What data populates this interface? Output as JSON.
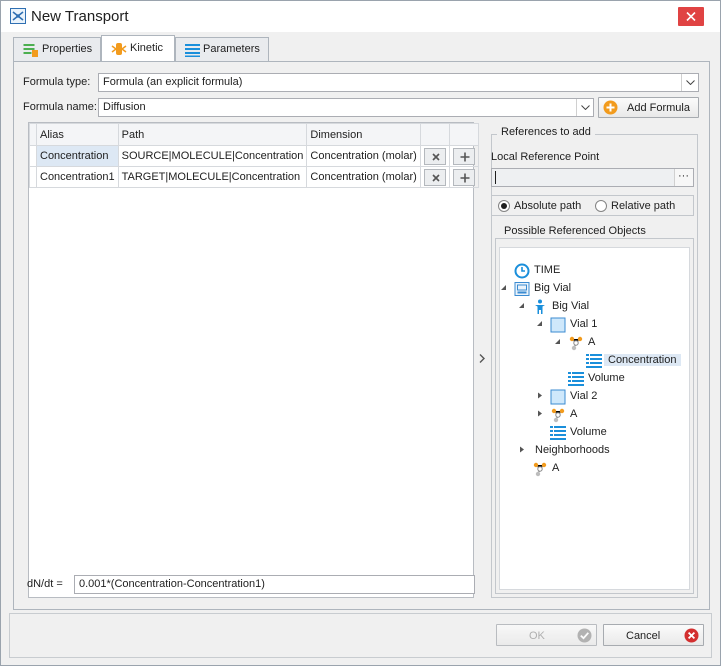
{
  "window": {
    "title": "New Transport"
  },
  "tabs": [
    {
      "label": "Properties",
      "active": false
    },
    {
      "label": "Kinetic",
      "active": true
    },
    {
      "label": "Parameters",
      "active": false
    }
  ],
  "form": {
    "formula_type_label": "Formula type:",
    "formula_type_value": "Formula (an explicit formula)",
    "formula_name_label": "Formula name:",
    "formula_name_value": "Diffusion",
    "add_formula_label": "Add Formula"
  },
  "grid": {
    "headers": [
      "Alias",
      "Path",
      "Dimension"
    ],
    "rows": [
      {
        "alias": "Concentration",
        "path": "SOURCE|MOLECULE|Concentration",
        "dimension": "Concentration (molar)"
      },
      {
        "alias": "Concentration1",
        "path": "TARGET|MOLECULE|Concentration",
        "dimension": "Concentration (molar)"
      }
    ]
  },
  "formula": {
    "label": "dN/dt =",
    "expression": "0.001*(Concentration-Concentration1)"
  },
  "references": {
    "title": "References to add",
    "local_ref_label": "Local Reference Point",
    "local_ref_value": "",
    "browse_label": "···",
    "absolute_label": "Absolute path",
    "relative_label": "Relative path",
    "selected_mode": "absolute",
    "tree_title": "Possible Referenced Objects",
    "tree": [
      {
        "label": "TIME",
        "icon": "clock-icon"
      },
      {
        "label": "Big Vial",
        "icon": "container-icon"
      },
      {
        "label": "Big Vial",
        "icon": "organism-icon"
      },
      {
        "label": "Vial 1",
        "icon": "compartment-icon"
      },
      {
        "label": "A",
        "icon": "molecule-icon"
      },
      {
        "label": "Concentration",
        "icon": "parameter-icon",
        "selected": true
      },
      {
        "label": "Volume",
        "icon": "parameter-icon"
      },
      {
        "label": "Vial 2",
        "icon": "compartment-icon"
      },
      {
        "label": "A",
        "icon": "molecule-icon"
      },
      {
        "label": "Volume",
        "icon": "parameter-icon"
      },
      {
        "label": "Neighborhoods",
        "icon": "none"
      },
      {
        "label": "A",
        "icon": "molecule-icon"
      }
    ]
  },
  "footer": {
    "ok_label": "OK",
    "cancel_label": "Cancel"
  },
  "colors": {
    "accent": "#1a8fdb",
    "selection": "#dde8f4",
    "close": "#e04343",
    "add_formula_icon": "#f29b1d",
    "cancel_icon": "#d32f2f",
    "ok_icon": "#9e9e9e"
  }
}
